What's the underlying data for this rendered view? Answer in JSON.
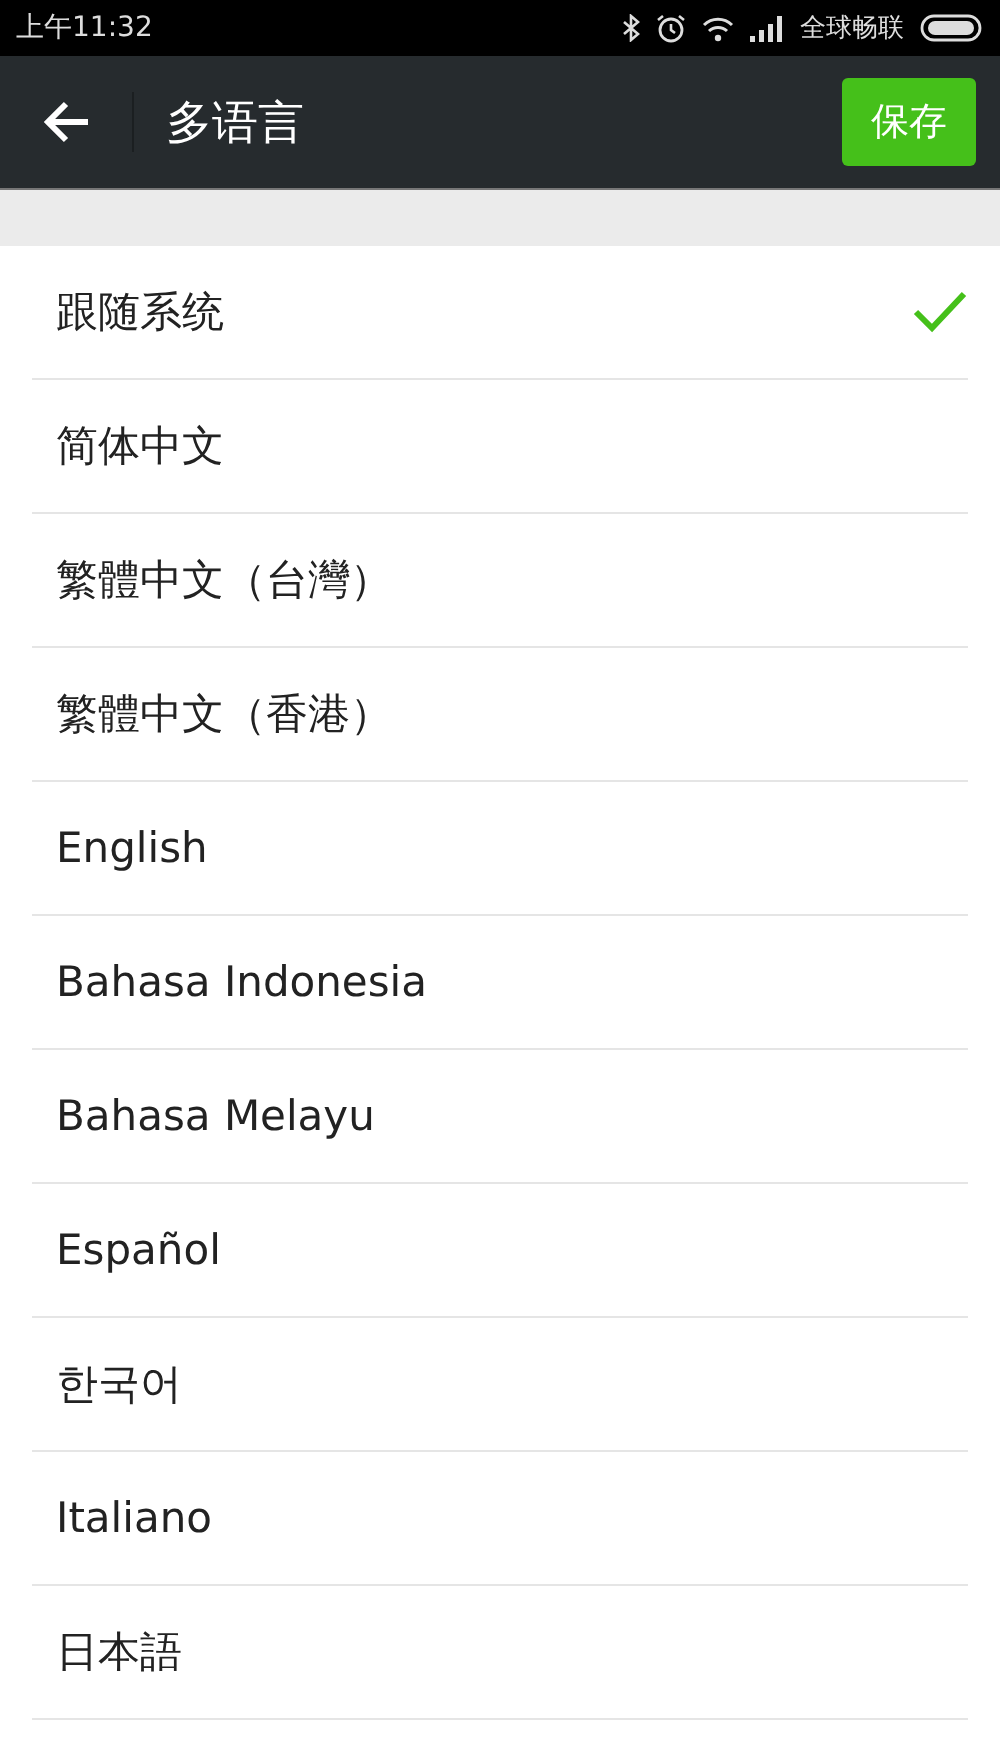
{
  "status_bar": {
    "time": "上午11:32",
    "carrier": "全球畅联"
  },
  "header": {
    "title": "多语言",
    "save_button": "保存"
  },
  "languages": [
    {
      "label": "跟随系统",
      "selected": true
    },
    {
      "label": "简体中文",
      "selected": false
    },
    {
      "label": "繁體中文（台灣）",
      "selected": false
    },
    {
      "label": "繁體中文（香港）",
      "selected": false
    },
    {
      "label": "English",
      "selected": false
    },
    {
      "label": "Bahasa Indonesia",
      "selected": false
    },
    {
      "label": "Bahasa Melayu",
      "selected": false
    },
    {
      "label": "Español",
      "selected": false
    },
    {
      "label": "한국어",
      "selected": false
    },
    {
      "label": "Italiano",
      "selected": false
    },
    {
      "label": "日本語",
      "selected": false
    }
  ]
}
